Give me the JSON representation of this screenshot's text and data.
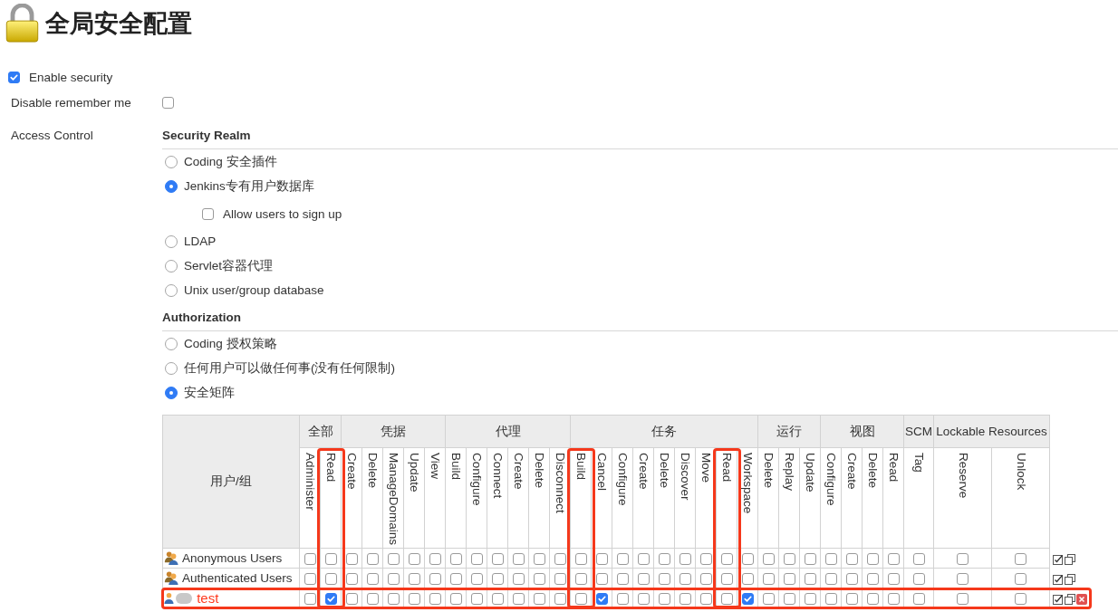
{
  "title": "全局安全配置",
  "enable_security": {
    "label": "Enable security",
    "checked": true
  },
  "disable_remember_me": {
    "label": "Disable remember me",
    "checked": false
  },
  "access_control": {
    "label": "Access Control",
    "security_realm": {
      "heading": "Security Realm",
      "options": [
        {
          "label": "Coding 安全插件",
          "selected": false
        },
        {
          "label": "Jenkins专有用户数据库",
          "selected": true,
          "sub_option": {
            "label": "Allow users to sign up",
            "checked": false
          }
        },
        {
          "label": "LDAP",
          "selected": false
        },
        {
          "label": "Servlet容器代理",
          "selected": false
        },
        {
          "label": "Unix user/group database",
          "selected": false
        }
      ]
    },
    "authorization": {
      "heading": "Authorization",
      "options": [
        {
          "label": "Coding 授权策略",
          "selected": false
        },
        {
          "label": "任何用户可以做任何事(没有任何限制)",
          "selected": false
        },
        {
          "label": "安全矩阵",
          "selected": true
        }
      ]
    }
  },
  "matrix": {
    "user_header": "用户/组",
    "groups": [
      {
        "label": "全部",
        "permissions": [
          {
            "label": "Administer",
            "highlighted": false
          },
          {
            "label": "Read",
            "highlighted": true
          }
        ]
      },
      {
        "label": "凭据",
        "permissions": [
          {
            "label": "Create",
            "highlighted": false
          },
          {
            "label": "Delete",
            "highlighted": false
          },
          {
            "label": "ManageDomains",
            "highlighted": false
          },
          {
            "label": "Update",
            "highlighted": false
          },
          {
            "label": "View",
            "highlighted": false
          }
        ]
      },
      {
        "label": "代理",
        "permissions": [
          {
            "label": "Build",
            "highlighted": false
          },
          {
            "label": "Configure",
            "highlighted": false
          },
          {
            "label": "Connect",
            "highlighted": false
          },
          {
            "label": "Create",
            "highlighted": false
          },
          {
            "label": "Delete",
            "highlighted": false
          },
          {
            "label": "Disconnect",
            "highlighted": false
          }
        ]
      },
      {
        "label": "任务",
        "permissions": [
          {
            "label": "Build",
            "highlighted": true
          },
          {
            "label": "Cancel",
            "highlighted": false
          },
          {
            "label": "Configure",
            "highlighted": false
          },
          {
            "label": "Create",
            "highlighted": false
          },
          {
            "label": "Delete",
            "highlighted": false
          },
          {
            "label": "Discover",
            "highlighted": false
          },
          {
            "label": "Move",
            "highlighted": false
          },
          {
            "label": "Read",
            "highlighted": true
          },
          {
            "label": "Workspace",
            "highlighted": false
          }
        ]
      },
      {
        "label": "运行",
        "permissions": [
          {
            "label": "Delete",
            "highlighted": false
          },
          {
            "label": "Replay",
            "highlighted": false
          },
          {
            "label": "Update",
            "highlighted": false
          }
        ]
      },
      {
        "label": "视图",
        "permissions": [
          {
            "label": "Configure",
            "highlighted": false
          },
          {
            "label": "Create",
            "highlighted": false
          },
          {
            "label": "Delete",
            "highlighted": false
          },
          {
            "label": "Read",
            "highlighted": false
          }
        ]
      },
      {
        "label": "SCM",
        "permissions": [
          {
            "label": "Tag",
            "highlighted": false
          }
        ]
      },
      {
        "label": "Lockable Resources",
        "permissions": [
          {
            "label": "Reserve",
            "highlighted": false
          },
          {
            "label": "Unlock",
            "highlighted": false
          }
        ]
      }
    ],
    "rows": [
      {
        "kind": "group",
        "name": "Anonymous Users",
        "highlighted": false,
        "redacted": false,
        "deletable": false,
        "permissions": [
          false,
          false,
          false,
          false,
          false,
          false,
          false,
          false,
          false,
          false,
          false,
          false,
          false,
          false,
          false,
          false,
          false,
          false,
          false,
          false,
          false,
          false,
          false,
          false,
          false,
          false,
          false,
          false,
          false,
          false,
          false,
          false
        ]
      },
      {
        "kind": "group",
        "name": "Authenticated Users",
        "highlighted": false,
        "redacted": false,
        "deletable": false,
        "permissions": [
          false,
          false,
          false,
          false,
          false,
          false,
          false,
          false,
          false,
          false,
          false,
          false,
          false,
          false,
          false,
          false,
          false,
          false,
          false,
          false,
          false,
          false,
          false,
          false,
          false,
          false,
          false,
          false,
          false,
          false,
          false,
          false
        ]
      },
      {
        "kind": "user",
        "name": "test",
        "highlighted": true,
        "redacted": true,
        "deletable": true,
        "permissions": [
          false,
          true,
          false,
          false,
          false,
          false,
          false,
          false,
          false,
          false,
          false,
          false,
          false,
          false,
          true,
          false,
          false,
          false,
          false,
          false,
          false,
          true,
          false,
          false,
          false,
          false,
          false,
          false,
          false,
          false,
          false,
          false
        ]
      }
    ]
  }
}
